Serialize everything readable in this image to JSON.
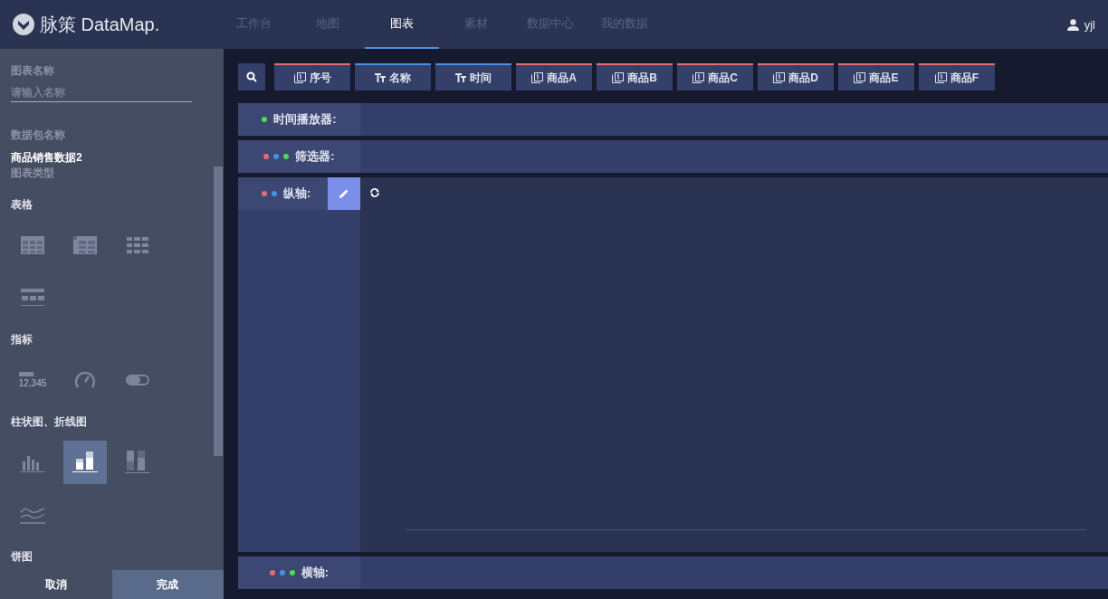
{
  "header": {
    "logo": "脉策 DataMap.",
    "nav": [
      {
        "label": "工作台",
        "selected": false
      },
      {
        "label": "地图",
        "selected": false
      },
      {
        "label": "图表",
        "selected": true
      },
      {
        "label": "素材",
        "selected": false
      },
      {
        "label": "数据中心",
        "selected": false
      },
      {
        "label": "我的数据",
        "selected": false
      }
    ],
    "user": "yjl"
  },
  "sidebar": {
    "name_label": "图表名称",
    "name_placeholder": "请输入名称",
    "package_label": "数据包名称",
    "package_value": "商品销售数据2",
    "type_label": "图表类型",
    "sections": [
      {
        "title": "表格",
        "items": [
          {
            "kind": "table",
            "selected": false
          },
          {
            "kind": "header-table",
            "selected": false
          },
          {
            "kind": "grid",
            "selected": false
          },
          {
            "kind": "list-table",
            "selected": false
          }
        ]
      },
      {
        "title": "指标",
        "items": [
          {
            "kind": "number",
            "label": "12,345",
            "selected": false
          },
          {
            "kind": "gauge",
            "selected": false
          },
          {
            "kind": "toggle",
            "selected": false
          }
        ]
      },
      {
        "title": "柱状图、折线图",
        "items": [
          {
            "kind": "bar",
            "selected": false
          },
          {
            "kind": "stacked-bar",
            "selected": true
          },
          {
            "kind": "full-stacked-bar",
            "selected": false
          },
          {
            "kind": "line",
            "selected": false
          }
        ]
      },
      {
        "title": "饼图"
      }
    ],
    "cancel": "取消",
    "done": "完成"
  },
  "fields": [
    {
      "kind": "number",
      "label": "序号",
      "color": "#e66b73"
    },
    {
      "kind": "text",
      "label": "名称",
      "color": "#4a8fe6"
    },
    {
      "kind": "text",
      "label": "时间",
      "color": "#4a8fe6"
    },
    {
      "kind": "number",
      "label": "商品A",
      "color": "#e66b73"
    },
    {
      "kind": "number",
      "label": "商品B",
      "color": "#e66b73"
    },
    {
      "kind": "number",
      "label": "商品C",
      "color": "#e66b73"
    },
    {
      "kind": "number",
      "label": "商品D",
      "color": "#e66b73"
    },
    {
      "kind": "number",
      "label": "商品E",
      "color": "#e66b73"
    },
    {
      "kind": "number",
      "label": "商品F",
      "color": "#e66b73"
    }
  ],
  "zones": [
    {
      "kind": "bar",
      "label": "时间播放器:",
      "dots": [
        {
          "color": "#4ddc4d"
        }
      ]
    },
    {
      "kind": "bar",
      "label": "筛选器:",
      "dots": [
        {
          "color": "#e66b73"
        },
        {
          "color": "#4a8fe6"
        },
        {
          "color": "#4ddc4d"
        }
      ]
    },
    {
      "kind": "axis",
      "label": "纵轴:",
      "dots": [
        {
          "color": "#e66b73"
        },
        {
          "color": "#4a8fe6"
        }
      ]
    },
    {
      "kind": "bar",
      "label": "横轴:",
      "dots": [
        {
          "color": "#e66b73"
        },
        {
          "color": "#4a8fe6"
        },
        {
          "color": "#4ddc4d"
        }
      ]
    }
  ]
}
